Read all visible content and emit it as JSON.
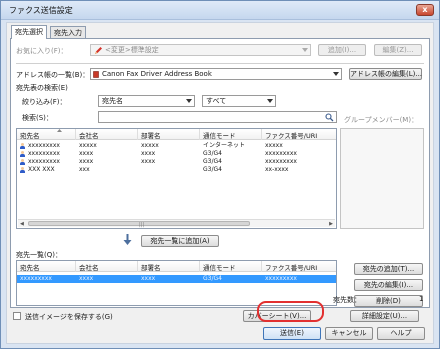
{
  "window": {
    "title": "ファクス送信設定",
    "close_glyph": "x"
  },
  "tabs": [
    {
      "label": "宛先選択",
      "active": true
    },
    {
      "label": "宛先入力",
      "active": false
    }
  ],
  "favorites": {
    "label": "お気に入り(F)：",
    "value": "<変更>標準設定",
    "add_button": "追加(I)...",
    "edit_button": "編集(Z)..."
  },
  "address_book": {
    "label": "アドレス帳の一覧(B)：",
    "value": "Canon Fax Driver Address Book",
    "edit_button": "アドレス帳の編集(L)..."
  },
  "search_section": {
    "title": "宛先表の検索(E)",
    "filter_label": "絞り込み(F)：",
    "filter_field": "宛先名",
    "filter_scope": "すべて",
    "search_label": "検索(S)：",
    "search_value": ""
  },
  "group_members_label": "グループメンバー(M)：",
  "address_list": {
    "columns": [
      "宛先名",
      "会社名",
      "部署名",
      "通信モード",
      "ファクス番号/URI"
    ],
    "rows": [
      [
        "xxxxxxxxx",
        "xxxxx",
        "xxxxx",
        "インターネット",
        "xxxxx"
      ],
      [
        "xxxxxxxxx",
        "xxxx",
        "xxxx",
        "G3/G4",
        "xxxxxxxxx"
      ],
      [
        "xxxxxxxxx",
        "xxxx",
        "xxxx",
        "G3/G4",
        "xxxxxxxxx"
      ],
      [
        "XXX XXX",
        "xxx",
        "",
        "G3/G4",
        "xx-xxxx"
      ]
    ]
  },
  "add_to_list_button": "宛先一覧に追加(A)",
  "destination_list": {
    "label": "宛先一覧(Q)：",
    "columns": [
      "宛先名",
      "会社名",
      "部署名",
      "通信モード",
      "ファクス番号/URI"
    ],
    "rows": [
      [
        "xxxxxxxxx",
        "xxxx",
        "xxxx",
        "G3/G4",
        "xxxxxxxxx"
      ]
    ]
  },
  "side_buttons": {
    "add_destination": "宛先の追加(T)...",
    "edit_destination": "宛先の編集(I)...",
    "delete": "削除(D)"
  },
  "destination_count": {
    "label": "宛先数：",
    "value": "1"
  },
  "options": {
    "save_image_label": "送信イメージを保存する(G)",
    "cover_sheet": "カバーシート(V)...",
    "details": "詳細設定(U)..."
  },
  "footer": {
    "send": "送信(E)",
    "cancel": "キャンセル",
    "help": "ヘルプ"
  },
  "accent_colors": {
    "selection": "#3399ff",
    "send_highlight": "#e23030",
    "title_bar": "#c5d7ee"
  }
}
